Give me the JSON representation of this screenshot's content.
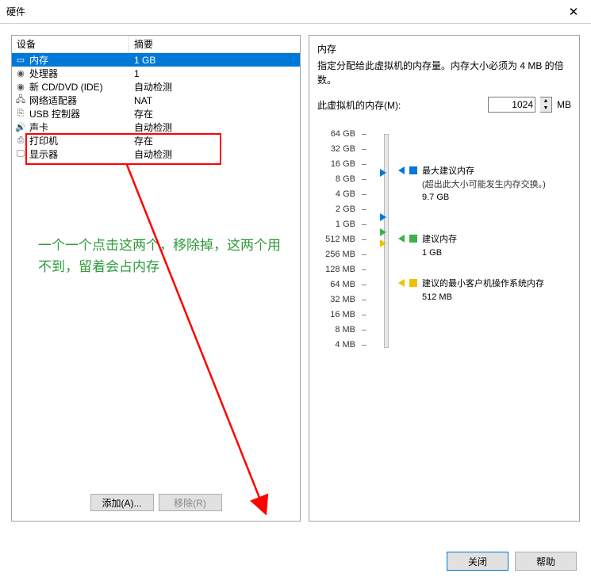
{
  "title": "硬件",
  "hardware": {
    "columns": {
      "device": "设备",
      "summary": "摘要"
    },
    "rows": [
      {
        "icon": "memory-icon",
        "name": "内存",
        "summary": "1 GB",
        "selected": true
      },
      {
        "icon": "cpu-icon",
        "name": "处理器",
        "summary": "1"
      },
      {
        "icon": "disc-icon",
        "name": "新 CD/DVD (IDE)",
        "summary": "自动检测"
      },
      {
        "icon": "net-icon",
        "name": "网络适配器",
        "summary": "NAT"
      },
      {
        "icon": "usb-icon",
        "name": "USB 控制器",
        "summary": "存在"
      },
      {
        "icon": "sound-icon",
        "name": "声卡",
        "summary": "自动检测"
      },
      {
        "icon": "printer-icon",
        "name": "打印机",
        "summary": "存在"
      },
      {
        "icon": "display-icon",
        "name": "显示器",
        "summary": "自动检测"
      }
    ]
  },
  "buttons": {
    "add": "添加(A)...",
    "remove": "移除(R)",
    "close": "关闭",
    "help": "帮助"
  },
  "memory": {
    "title": "内存",
    "desc": "指定分配给此虚拟机的内存量。内存大小必须为 4 MB 的倍数。",
    "input_label": "此虚拟机的内存(M):",
    "input_value": "1024",
    "unit": "MB",
    "ticks": [
      "64 GB",
      "32 GB",
      "16 GB",
      "8 GB",
      "4 GB",
      "2 GB",
      "1 GB",
      "512 MB",
      "256 MB",
      "128 MB",
      "64 MB",
      "32 MB",
      "16 MB",
      "8 MB",
      "4 MB"
    ],
    "legend": {
      "max": {
        "label": "最大建议内存",
        "sub": "(超出此大小可能发生内存交换。)",
        "value": "9.7 GB"
      },
      "rec": {
        "label": "建议内存",
        "value": "1 GB"
      },
      "min": {
        "label": "建议的最小客户机操作系统内存",
        "value": "512 MB"
      }
    }
  },
  "annotation": "一个一个点击这两个，移除掉，这两个用不到，留着会占内存"
}
